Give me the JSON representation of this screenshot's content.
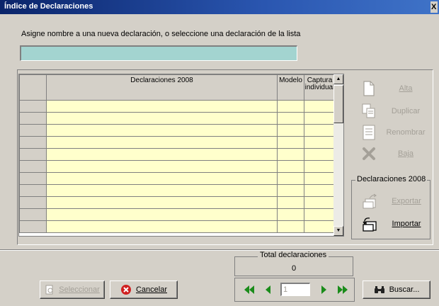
{
  "window": {
    "title": "Índice de Declaraciones",
    "close_glyph": "X"
  },
  "prompt": "Asigne nombre a una nueva declaración, o seleccione una declaración de la lista",
  "name_input": {
    "value": "",
    "placeholder": ""
  },
  "grid": {
    "columns": [
      "",
      "Declaraciones 2008",
      "Modelo",
      "Captura individual"
    ],
    "rows": 11
  },
  "actions": {
    "alta": "Alta",
    "duplicar": "Duplicar",
    "renombrar": "Renombrar",
    "baja": "Baja"
  },
  "group": {
    "title": "Declaraciones 2008",
    "exportar": "Exportar",
    "importar": "Importar"
  },
  "total": {
    "title": "Total declaraciones",
    "value": "0"
  },
  "nav": {
    "page": "1"
  },
  "buttons": {
    "seleccionar": "Seleccionar",
    "cancelar": "Cancelar",
    "buscar": "Buscar..."
  },
  "colors": {
    "cell_bg": "#ffffcc",
    "input_bg": "#a3d4d0",
    "nav_green": "#1a8c1a",
    "cancel_red": "#d02020"
  },
  "icons": [
    "new-page-icon",
    "duplicate-icon",
    "rename-icon",
    "delete-x-icon",
    "export-icon",
    "import-icon",
    "first-page-icon",
    "prev-page-icon",
    "next-page-icon",
    "last-page-icon",
    "binoculars-icon",
    "cancel-icon",
    "select-icon"
  ]
}
